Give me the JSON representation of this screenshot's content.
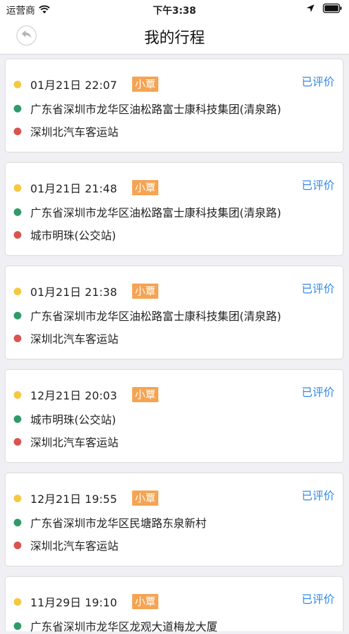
{
  "status_bar": {
    "carrier": "运营商",
    "time": "下午3:38",
    "icons": [
      "wifi-icon",
      "location-arrow-icon",
      "battery-icon"
    ]
  },
  "nav": {
    "title": "我的行程",
    "back_icon": "back-arrow-icon"
  },
  "colors": {
    "time_dot": "#f5c842",
    "start_dot": "#2e9b69",
    "end_dot": "#d9534f",
    "tag_bg": "#f6a352",
    "link": "#2f88e8"
  },
  "trips": [
    {
      "time": "01月21日 22:07",
      "tag": "小覃",
      "status": "已评价",
      "start": "广东省深圳市龙华区油松路富士康科技集团(清泉路)",
      "end": "深圳北汽车客运站"
    },
    {
      "time": "01月21日 21:48",
      "tag": "小覃",
      "status": "已评价",
      "start": "广东省深圳市龙华区油松路富士康科技集团(清泉路)",
      "end": "城市明珠(公交站)"
    },
    {
      "time": "01月21日 21:38",
      "tag": "小覃",
      "status": "已评价",
      "start": "广东省深圳市龙华区油松路富士康科技集团(清泉路)",
      "end": "深圳北汽车客运站"
    },
    {
      "time": "12月21日 20:03",
      "tag": "小覃",
      "status": "已评价",
      "start": "城市明珠(公交站)",
      "end": "深圳北汽车客运站"
    },
    {
      "time": "12月21日 19:55",
      "tag": "小覃",
      "status": "已评价",
      "start": "广东省深圳市龙华区民塘路东泉新村",
      "end": "深圳北汽车客运站"
    },
    {
      "time": "11月29日 19:10",
      "tag": "小覃",
      "status": "已评价",
      "start": "广东省深圳市龙华区龙观大道梅龙大厦",
      "end": ""
    }
  ]
}
